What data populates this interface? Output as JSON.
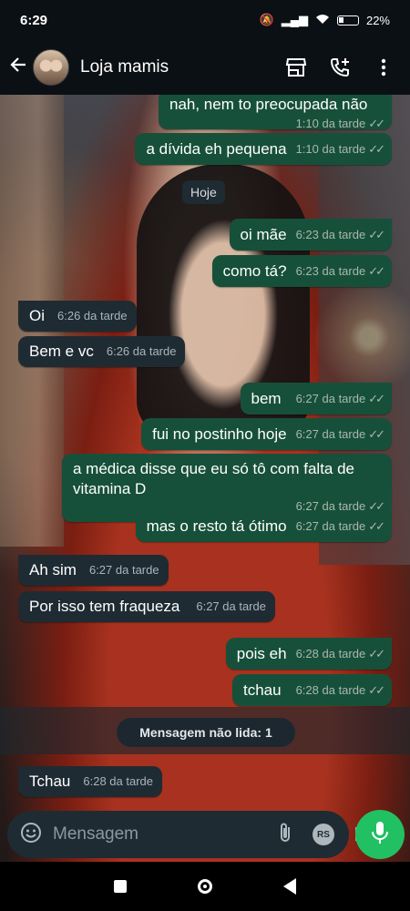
{
  "status_bar": {
    "time": "6:29",
    "battery": "22%"
  },
  "header": {
    "contact_name": "Loja mamis"
  },
  "chat": {
    "date_chip": "Hoje",
    "unread_label": "Mensagem não lida: 1",
    "messages": [
      {
        "dir": "out",
        "text": "nah, nem to preocupada não",
        "time": "1:10 da tarde"
      },
      {
        "dir": "out",
        "text": "a dívida eh pequena",
        "time": "1:10 da tarde"
      },
      {
        "dir": "out",
        "text": "oi mãe",
        "time": "6:23 da tarde"
      },
      {
        "dir": "out",
        "text": "como tá?",
        "time": "6:23 da tarde"
      },
      {
        "dir": "in",
        "text": "Oi",
        "time": "6:26 da tarde"
      },
      {
        "dir": "in",
        "text": "Bem e vc",
        "time": "6:26 da tarde"
      },
      {
        "dir": "out",
        "text": "bem",
        "time": "6:27 da tarde"
      },
      {
        "dir": "out",
        "text": "fui no postinho hoje",
        "time": "6:27 da tarde"
      },
      {
        "dir": "out",
        "text": "a médica disse que eu só tô com falta de vitamina D",
        "time": "6:27 da tarde"
      },
      {
        "dir": "out",
        "text": "mas o resto tá ótimo",
        "time": "6:27 da tarde"
      },
      {
        "dir": "in",
        "text": "Ah sim",
        "time": "6:27 da tarde"
      },
      {
        "dir": "in",
        "text": "Por isso tem fraqueza",
        "time": "6:27 da tarde"
      },
      {
        "dir": "out",
        "text": "pois eh",
        "time": "6:28 da tarde"
      },
      {
        "dir": "out",
        "text": "tchau",
        "time": "6:28 da tarde"
      },
      {
        "dir": "in",
        "text": "Tchau",
        "time": "6:28 da tarde"
      }
    ]
  },
  "composer": {
    "placeholder": "Mensagem",
    "rs_label": "RS"
  },
  "colors": {
    "outgoing_bubble": "#17503a",
    "incoming_bubble": "#1f2b33",
    "accent": "#21c063"
  },
  "icons": [
    "back-arrow-icon",
    "store-icon",
    "add-call-icon",
    "more-vert-icon",
    "emoji-icon",
    "attach-icon",
    "camera-icon",
    "mic-icon"
  ]
}
